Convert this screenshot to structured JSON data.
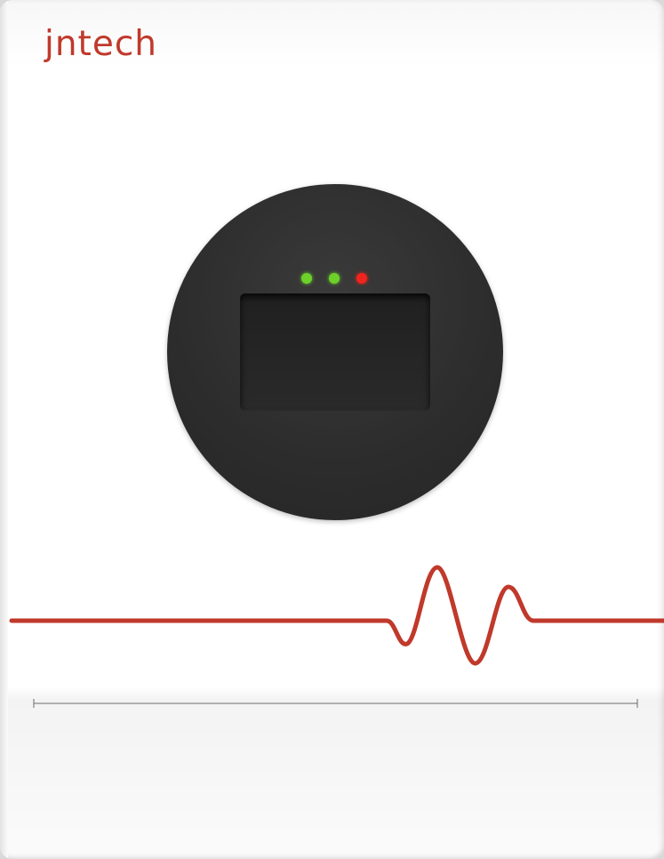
{
  "brand": {
    "logo_text": "jntech",
    "color": "#c0392b"
  },
  "panel": {
    "indicator_colors": [
      "#6dd12a",
      "#6dd12a",
      "#f0241e"
    ],
    "body_color": "#ffffff",
    "disc_color": "#2d2d2d"
  }
}
